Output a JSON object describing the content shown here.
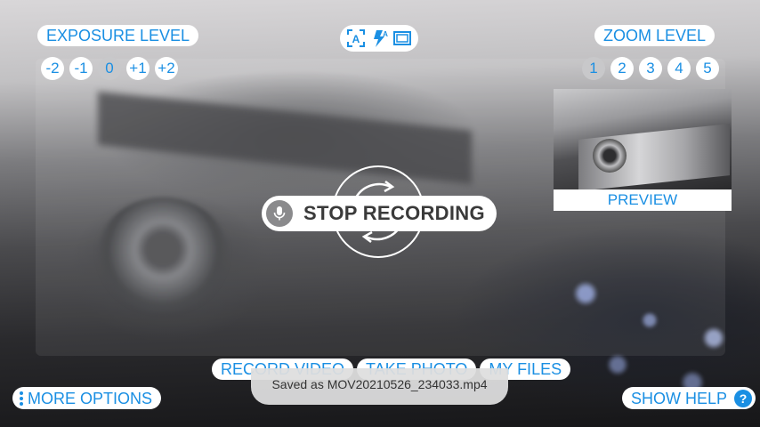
{
  "exposure": {
    "title": "EXPOSURE LEVEL",
    "levels": [
      "-2",
      "-1",
      "0",
      "+1",
      "+2"
    ],
    "selected": "0"
  },
  "zoom": {
    "title": "ZOOM LEVEL",
    "levels": [
      "1",
      "2",
      "3",
      "4",
      "5"
    ],
    "selected": "1"
  },
  "mode_bar": {
    "icons": [
      "auto-focus-icon",
      "auto-flash-icon",
      "aspect-ratio-icon"
    ],
    "auto_focus_glyph": "A",
    "flash_glyph": "A"
  },
  "preview": {
    "label": "PREVIEW"
  },
  "recording": {
    "stop_label": "STOP RECORDING",
    "mic_icon": "microphone-icon"
  },
  "tabs": [
    "RECORD VIDEO",
    "TAKE PHOTO",
    "MY FILES"
  ],
  "more_options": {
    "label": "MORE OPTIONS",
    "icon": "vertical-dots-icon"
  },
  "show_help": {
    "label": "SHOW HELP",
    "icon_glyph": "?"
  },
  "toast": {
    "message": "Saved as MOV20210526_234033.mp4"
  },
  "colors": {
    "accent": "#1a8fe3",
    "selected_bg": "#c8c8ca",
    "toast_bg": "#dedede"
  }
}
